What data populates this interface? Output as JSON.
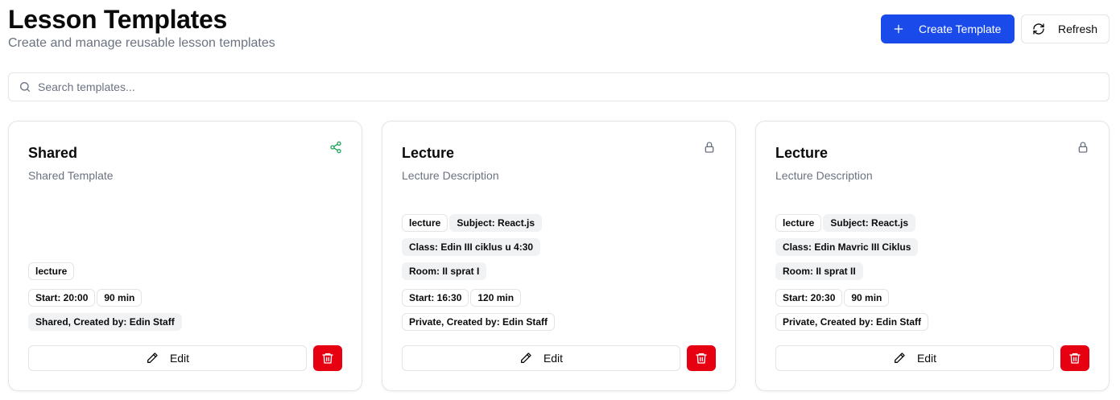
{
  "header": {
    "title": "Lesson Templates",
    "subtitle": "Create and manage reusable lesson templates"
  },
  "actions": {
    "create_label": "Create Template",
    "create_icon": "plus-icon",
    "refresh_label": "Refresh",
    "refresh_icon": "refresh-icon"
  },
  "search": {
    "placeholder": "Search templates...",
    "value": "",
    "icon": "search-icon"
  },
  "colors": {
    "primary": "#1a4bea",
    "danger": "#e60012",
    "shared": "#22a35a",
    "muted": "#6b7280",
    "border": "#e2e4e8"
  },
  "cards": [
    {
      "title": "Shared",
      "description": "Shared Template",
      "status_icon": "share-icon",
      "type": "lecture",
      "subject": "",
      "class": "",
      "room": "",
      "start": "Start: 20:00",
      "duration": "90 min",
      "visibility": "Shared, Created by: Edin Staff",
      "edit_label": "Edit"
    },
    {
      "title": "Lecture",
      "description": "Lecture Description",
      "status_icon": "lock-icon",
      "type": "lecture",
      "subject": "Subject: React.js",
      "class": "Class: Edin III ciklus u 4:30",
      "room": "Room: II sprat I",
      "start": "Start: 16:30",
      "duration": "120 min",
      "visibility": "Private, Created by: Edin Staff",
      "edit_label": "Edit"
    },
    {
      "title": "Lecture",
      "description": "Lecture Description",
      "status_icon": "lock-icon",
      "type": "lecture",
      "subject": "Subject: React.js",
      "class": "Class: Edin Mavric III Ciklus",
      "room": "Room: II sprat II",
      "start": "Start: 20:30",
      "duration": "90 min",
      "visibility": "Private, Created by: Edin Staff",
      "edit_label": "Edit"
    }
  ]
}
